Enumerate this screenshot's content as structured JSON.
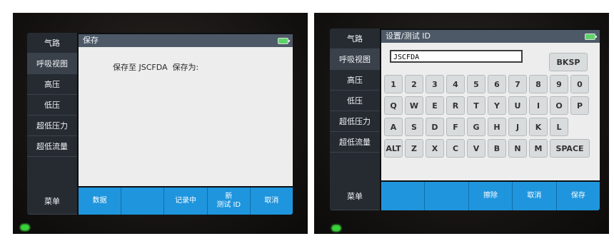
{
  "left_screen": {
    "sidebar": [
      "气路",
      "呼吸视图",
      "高压",
      "低压",
      "超低压力",
      "超低流量",
      "菜单"
    ],
    "sidebar_selected": 1,
    "title": "保存",
    "message": "保存至 JSCFDA  保存为:",
    "softkeys": [
      "数据",
      "",
      "记录中",
      "新\n测试 ID",
      "取消"
    ]
  },
  "right_screen": {
    "sidebar": [
      "气路",
      "呼吸视图",
      "高压",
      "低压",
      "超低压力",
      "超低流量",
      "菜单"
    ],
    "sidebar_selected": 1,
    "title": "设置/测试 ID",
    "id_value": "JSCFDA",
    "keyboard": {
      "bksp": "BKSP",
      "row1": [
        "1",
        "2",
        "3",
        "4",
        "5",
        "6",
        "7",
        "8",
        "9",
        "0"
      ],
      "row2": [
        "Q",
        "W",
        "E",
        "R",
        "T",
        "Y",
        "U",
        "I",
        "O",
        "P"
      ],
      "row3": [
        "A",
        "S",
        "D",
        "F",
        "G",
        "H",
        "J",
        "K",
        "L"
      ],
      "row4": [
        "ALT",
        "Z",
        "X",
        "C",
        "V",
        "B",
        "N",
        "M",
        "SPACE"
      ]
    },
    "softkeys": [
      "",
      "",
      "擦除",
      "取消",
      "保存"
    ]
  },
  "colors": {
    "softkey_bar": "#1f95dd",
    "sidebar": "#262b32",
    "titlebar": "#4d5966",
    "battery": "#5fd36b"
  }
}
